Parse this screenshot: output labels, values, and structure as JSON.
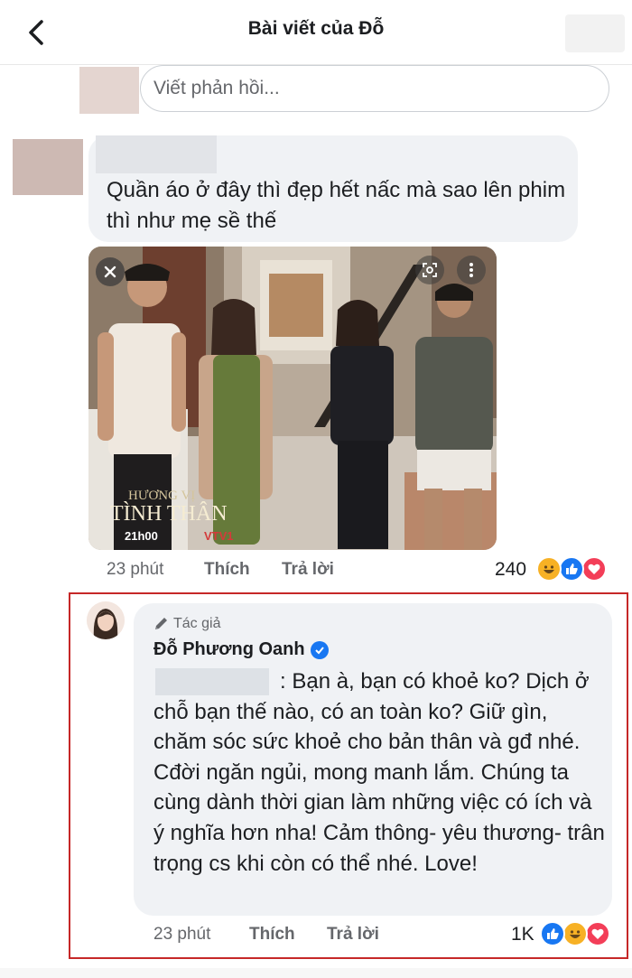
{
  "header": {
    "title": "Bài viết của Đỗ",
    "back_icon": "chevron-left-icon"
  },
  "reply_box": {
    "placeholder": "Viết phản hồi..."
  },
  "comment_1": {
    "text": "Quần áo ở đây thì đẹp hết nấc mà sao lên phim thì như mẹ sề thế",
    "image": {
      "title_line1": "HƯƠNG VỊ",
      "title_line2": "TÌNH THÂN",
      "airtime": "21h00",
      "channel": "VTV1"
    },
    "time": "23 phút",
    "like_label": "Thích",
    "reply_label": "Trả lời",
    "reaction_count": "240",
    "reactions": [
      "haha",
      "like",
      "love"
    ]
  },
  "comment_2": {
    "author_tag": "Tác giả",
    "author_name": "Đỗ Phương Oanh",
    "verified": true,
    "text": ": Bạn à, bạn có khoẻ ko? Dịch ở chỗ bạn thế nào, có an toàn ko? Giữ gìn, chăm sóc sức khoẻ cho bản thân và gđ nhé. Cđời ngăn ngủi, mong manh lắm. Chúng ta cùng dành thời gian làm những việc có ích và ý nghĩa hơn nha! Cảm thông- yêu thương- trân trọng cs khi còn có thể nhé. Love!",
    "time": "23 phút",
    "like_label": "Thích",
    "reply_label": "Trả lời",
    "reaction_count": "1K",
    "reactions": [
      "like",
      "haha",
      "love"
    ]
  },
  "colors": {
    "like_blue": "#1877f2",
    "love_red": "#f33e58",
    "haha_yellow": "#f7b125",
    "highlight_border": "#c62828",
    "bubble_bg": "#f0f2f5"
  }
}
